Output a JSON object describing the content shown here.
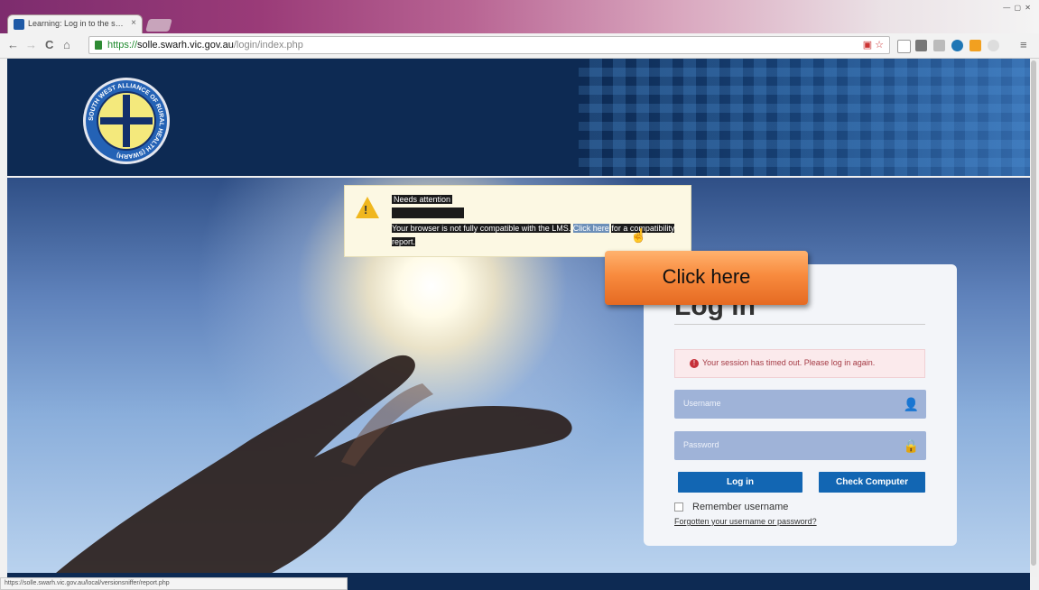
{
  "browser": {
    "tab_title": "Learning: Log in to the s…",
    "tab_close": "×",
    "window_controls": "— ▢ ✕",
    "url_scheme": "https://",
    "url_host": "solle.swarh.vic.gov.au",
    "url_path": "/login/index.php",
    "nav": {
      "back": "←",
      "forward": "→",
      "reload": "C",
      "home": "⌂",
      "menu": "≡"
    }
  },
  "header": {
    "logo_text": "SOUTH WEST ALLIANCE OF RURAL HEALTH (SWARH)"
  },
  "alert": {
    "title": "Needs attention",
    "body_prefix": "Your browser is not fully compatible with the LMS.",
    "link_text": "Click here",
    "body_suffix": "for a compatibility report."
  },
  "callout": {
    "label": "Click here"
  },
  "login": {
    "title": "Log in",
    "session_message": "Your session has timed out. Please log in again.",
    "username_placeholder": "Username",
    "password_placeholder": "Password",
    "login_button": "Log in",
    "check_button": "Check Computer",
    "remember_label": "Remember username",
    "forgot_link": "Forgotten your username or password?"
  },
  "status_bar": {
    "text": "https://solle.swarh.vic.gov.au/local/versionsniffer/report.php"
  },
  "colors": {
    "header_bg": "#0d2a53",
    "button": "#1266b3",
    "callout": "#f88b3e",
    "alert_bg": "#fcf8e3"
  }
}
